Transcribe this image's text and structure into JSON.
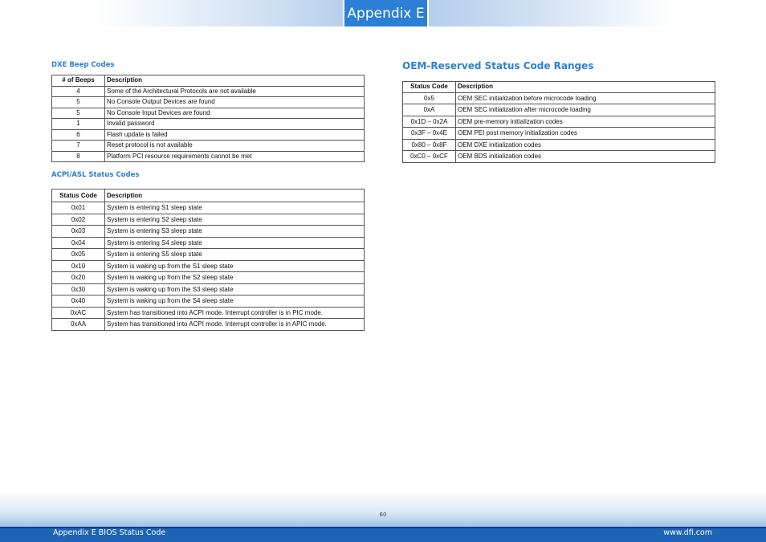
{
  "header": {
    "tab_label": "Appendix E"
  },
  "dxe": {
    "title": "DXE Beep Codes",
    "headers": [
      "# of Beeps",
      "Description"
    ],
    "rows": [
      [
        "4",
        "Some of the Architectural Protocols are not available"
      ],
      [
        "5",
        "No Console Output Devices are found"
      ],
      [
        "5",
        "No Console Input Devices are found"
      ],
      [
        "1",
        "Invalid password"
      ],
      [
        "6",
        "Flash update is failed"
      ],
      [
        "7",
        "Reset protocol is not available"
      ],
      [
        "8",
        "Platform PCI resource requirements cannot be met"
      ]
    ]
  },
  "acpi": {
    "title": "ACPI/ASL Status Codes",
    "headers": [
      "Status Code",
      "Description"
    ],
    "rows": [
      [
        "0x01",
        "System is entering S1 sleep state"
      ],
      [
        "0x02",
        "System is entering S2 sleep state"
      ],
      [
        "0x03",
        "System is entering S3 sleep state"
      ],
      [
        "0x04",
        "System is entering S4 sleep state"
      ],
      [
        "0x05",
        "System is entering S5 sleep state"
      ],
      [
        "0x10",
        "System is waking up from the S1 sleep state"
      ],
      [
        "0x20",
        "System is waking up from the S2 sleep state"
      ],
      [
        "0x30",
        "System is waking up from the S3 sleep state"
      ],
      [
        "0x40",
        "System is waking up from the S4 sleep state"
      ],
      [
        "0xAC",
        "System has transitioned into ACPI mode. Interrupt controller is in PIC mode."
      ],
      [
        "0xAA",
        "System has transitioned into ACPI mode. Interrupt controller is in APIC mode."
      ]
    ]
  },
  "oem": {
    "title": "OEM-Reserved Status Code Ranges",
    "headers": [
      "Status Code",
      "Description"
    ],
    "rows": [
      [
        "0x5",
        "OEM SEC initialization before microcode loading"
      ],
      [
        "0xA",
        "OEM SEC initialization after microcode loading"
      ],
      [
        "0x1D – 0x2A",
        "OEM pre-memory initialization codes"
      ],
      [
        "0x3F – 0x4E",
        "OEM PEI post memory initialization codes"
      ],
      [
        "0x80 – 0x8F",
        "OEM DXE initialization codes"
      ],
      [
        "0xC0 – 0xCF",
        "OEM BDS initialization codes"
      ]
    ]
  },
  "footer": {
    "page_number": "60",
    "left_text": "Appendix E BIOS Status Code",
    "right_text": "www.dfi.com"
  },
  "colors": {
    "accent": "#2b7fd4",
    "footer_bar": "#1d63b6"
  }
}
